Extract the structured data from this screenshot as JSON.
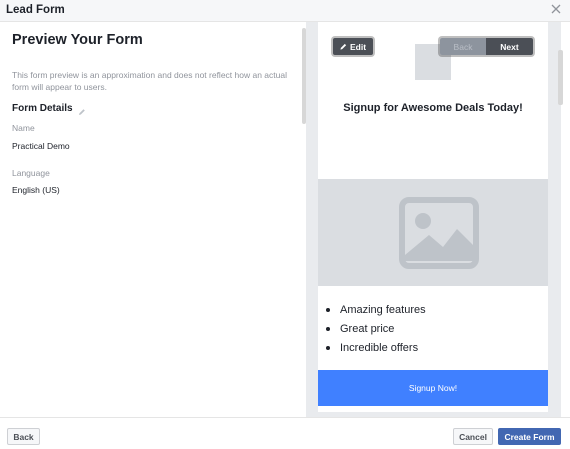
{
  "modal": {
    "title": "Lead Form",
    "close_icon": "close-icon"
  },
  "left": {
    "title": "Preview Your Form",
    "description": "This form preview is an approximation and does not reflect how an actual form will appear to users.",
    "details_heading": "Form Details",
    "details_edit_icon": "pencil-icon",
    "name_label": "Name",
    "name_value": "Practical Demo",
    "language_label": "Language",
    "language_value": "English (US)"
  },
  "preview": {
    "edit_label": "Edit",
    "back_label": "Back",
    "next_label": "Next",
    "headline": "Signup for Awesome Deals Today!",
    "image_icon": "image-placeholder-icon",
    "benefits": [
      "Amazing features",
      "Great price",
      "Incredible offers"
    ],
    "cta_label": "Signup Now!"
  },
  "footer": {
    "back_label": "Back",
    "cancel_label": "Cancel",
    "create_label": "Create Form"
  },
  "colors": {
    "primary": "#4267b2",
    "cta_blue": "#4080ff",
    "muted_text": "#90949c",
    "placeholder_gray": "#dadde1"
  }
}
